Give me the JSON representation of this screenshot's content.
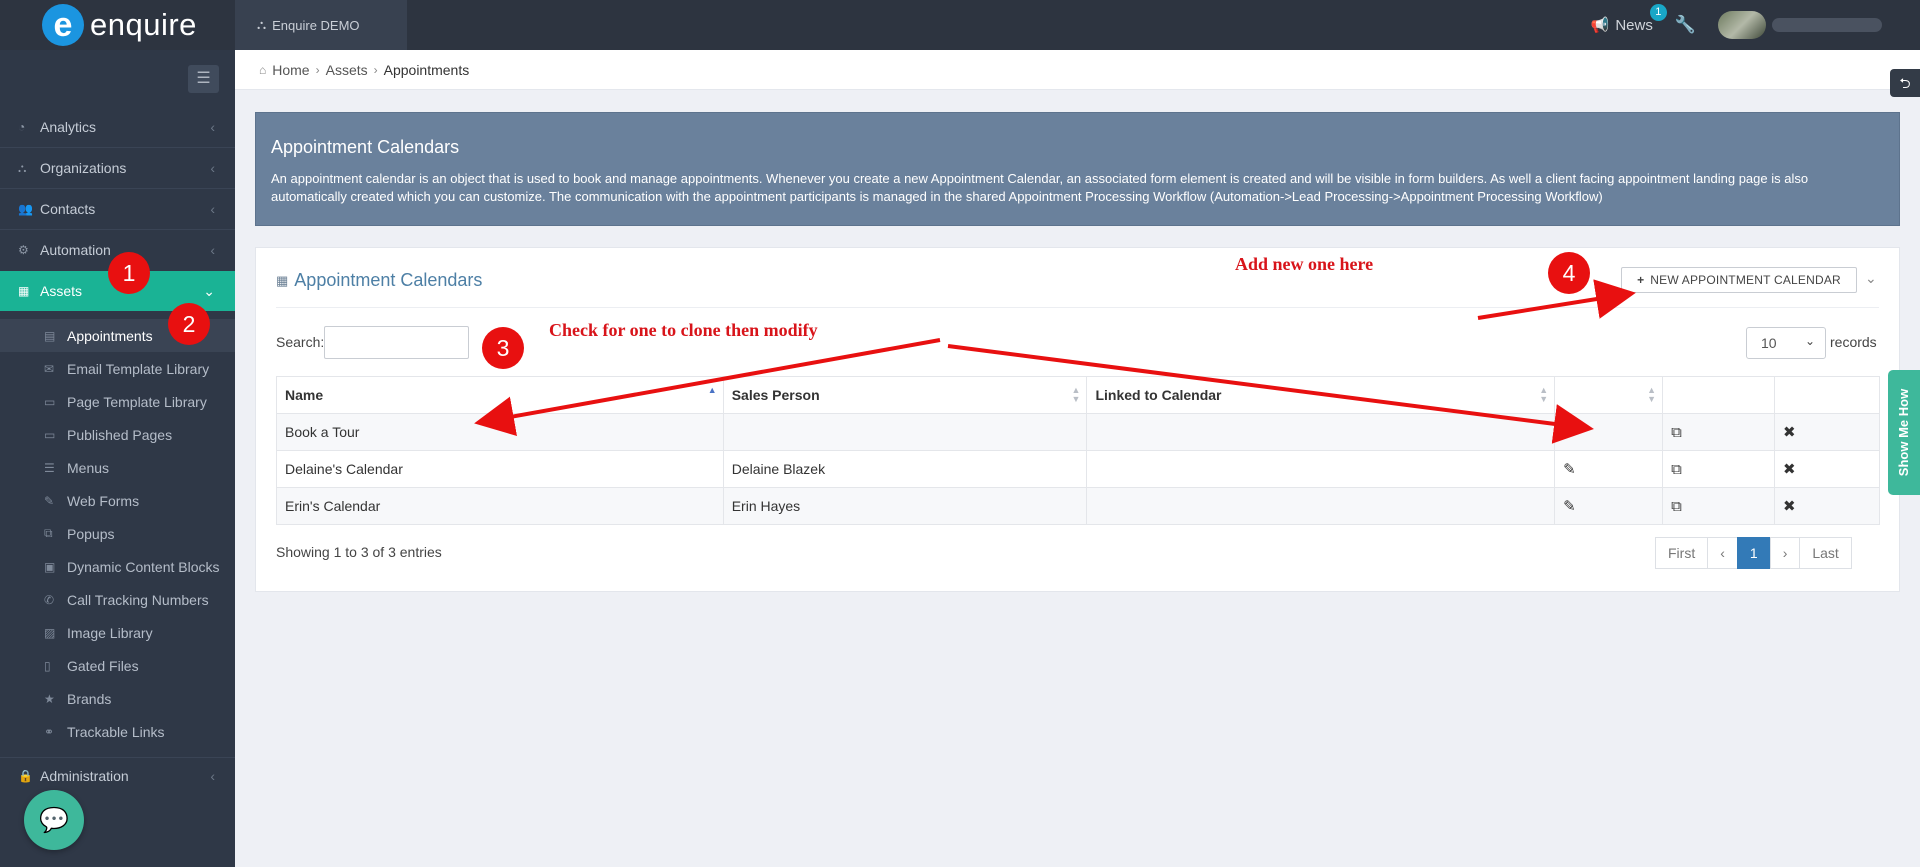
{
  "topbar": {
    "logo_mark": "e",
    "logo_text": "enquire",
    "account_name": "Enquire DEMO",
    "news_label": "News",
    "news_count": "1"
  },
  "sidebar": {
    "items": [
      {
        "label": "Analytics"
      },
      {
        "label": "Organizations"
      },
      {
        "label": "Contacts"
      },
      {
        "label": "Automation"
      },
      {
        "label": "Assets"
      }
    ],
    "sub_items": [
      {
        "label": "Appointments"
      },
      {
        "label": "Email Template Library"
      },
      {
        "label": "Page Template Library"
      },
      {
        "label": "Published Pages"
      },
      {
        "label": "Menus"
      },
      {
        "label": "Web Forms"
      },
      {
        "label": "Popups"
      },
      {
        "label": "Dynamic Content Blocks"
      },
      {
        "label": "Call Tracking Numbers"
      },
      {
        "label": "Image Library"
      },
      {
        "label": "Gated Files"
      },
      {
        "label": "Brands"
      },
      {
        "label": "Trackable Links"
      }
    ],
    "admin_label": "Administration"
  },
  "breadcrumb": {
    "home": "Home",
    "assets": "Assets",
    "current": "Appointments"
  },
  "info": {
    "title": "Appointment Calendars",
    "text": "An appointment calendar is an object that is used to book and manage appointments. Whenever you create a new Appointment Calendar, an associated form element is created and will be visible in form builders. As well a client facing appointment landing page is also automatically created which you can customize. The communication with the appointment participants is managed in the shared Appointment Processing Workflow (Automation->Lead Processing->Appointment Processing Workflow)"
  },
  "card": {
    "title": "Appointment Calendars",
    "new_button": "NEW APPOINTMENT CALENDAR",
    "search_label": "Search:",
    "length_value": "10",
    "records_label": "records",
    "columns": [
      "Name",
      "Sales Person",
      "Linked to Calendar"
    ],
    "rows": [
      {
        "name": "Book a Tour",
        "sales": "",
        "linked": ""
      },
      {
        "name": "Delaine's Calendar",
        "sales": "Delaine Blazek",
        "linked": ""
      },
      {
        "name": "Erin's Calendar",
        "sales": "Erin Hayes",
        "linked": ""
      }
    ],
    "footer": "Showing 1 to 3 of 3 entries",
    "pager": {
      "first": "First",
      "prev": "‹",
      "page": "1",
      "next": "›",
      "last": "Last"
    }
  },
  "show_me_how": "Show Me How",
  "annotations": {
    "badges": [
      "1",
      "2",
      "3",
      "4"
    ],
    "add_note": "Add new one here",
    "clone_note": "Check for one to clone then modify"
  },
  "colors": {
    "topbar": "#2d3440",
    "sidebar": "#2f3847",
    "active_nav": "#1ab395",
    "info_panel": "#6a819c",
    "accent_blue": "#337ab7",
    "annotation_red": "#e81010"
  }
}
